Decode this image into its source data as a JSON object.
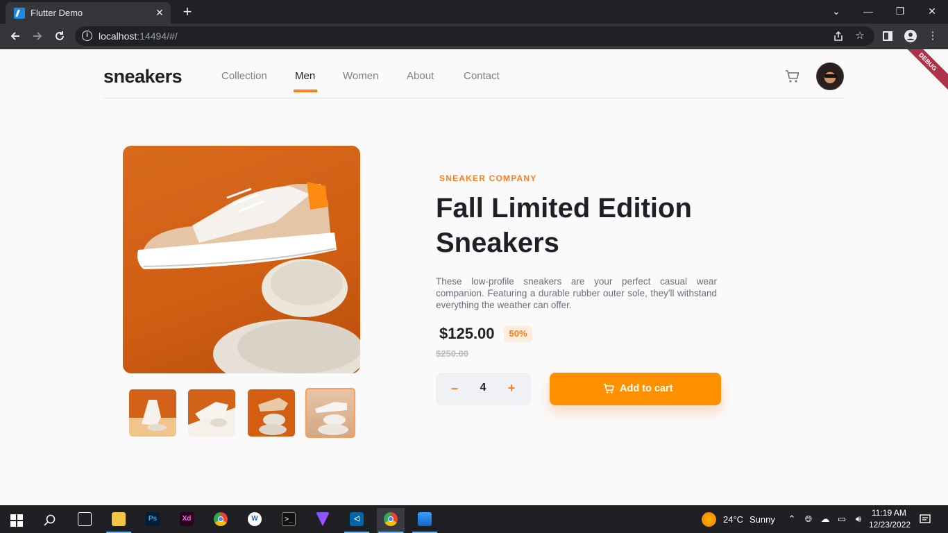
{
  "browser": {
    "tab_title": "Flutter Demo",
    "tab_close": "✕",
    "new_tab": "+",
    "url_host": "localhost",
    "url_rest": ":14494/#/",
    "window_controls": {
      "minimize": "—",
      "maximize": "❐",
      "close": "✕",
      "tab_search": "⌄"
    }
  },
  "site": {
    "brand": "sneakers",
    "nav": [
      {
        "label": "Collection",
        "active": false
      },
      {
        "label": "Men",
        "active": true
      },
      {
        "label": "Women",
        "active": false
      },
      {
        "label": "About",
        "active": false
      },
      {
        "label": "Contact",
        "active": false
      }
    ],
    "debug_banner": "DEBUG",
    "accent_color": "#ff7d1a"
  },
  "product": {
    "company": "SNEAKER COMPANY",
    "title": "Fall Limited Edition Sneakers",
    "description": "These low-profile sneakers are your perfect casual wear companion. Featuring a durable rubber outer sole, they'll withstand everything the weather can offer.",
    "price": "$125.00",
    "discount": "50%",
    "original_price": "$250.00",
    "quantity": "4",
    "qty_minus": "–",
    "qty_plus": "+",
    "add_to_cart": "Add to cart",
    "thumbnails_count": 4,
    "selected_thumbnail": 4
  },
  "taskbar": {
    "weather_temp": "24°C",
    "weather_text": "Sunny",
    "time": "11:19 AM",
    "date": "12/23/2022",
    "apps": [
      "task-view",
      "file-explorer",
      "photoshop",
      "adobe-xd",
      "chrome",
      "app-w",
      "terminal",
      "vpn",
      "vscode",
      "chrome-active",
      "photos"
    ]
  }
}
